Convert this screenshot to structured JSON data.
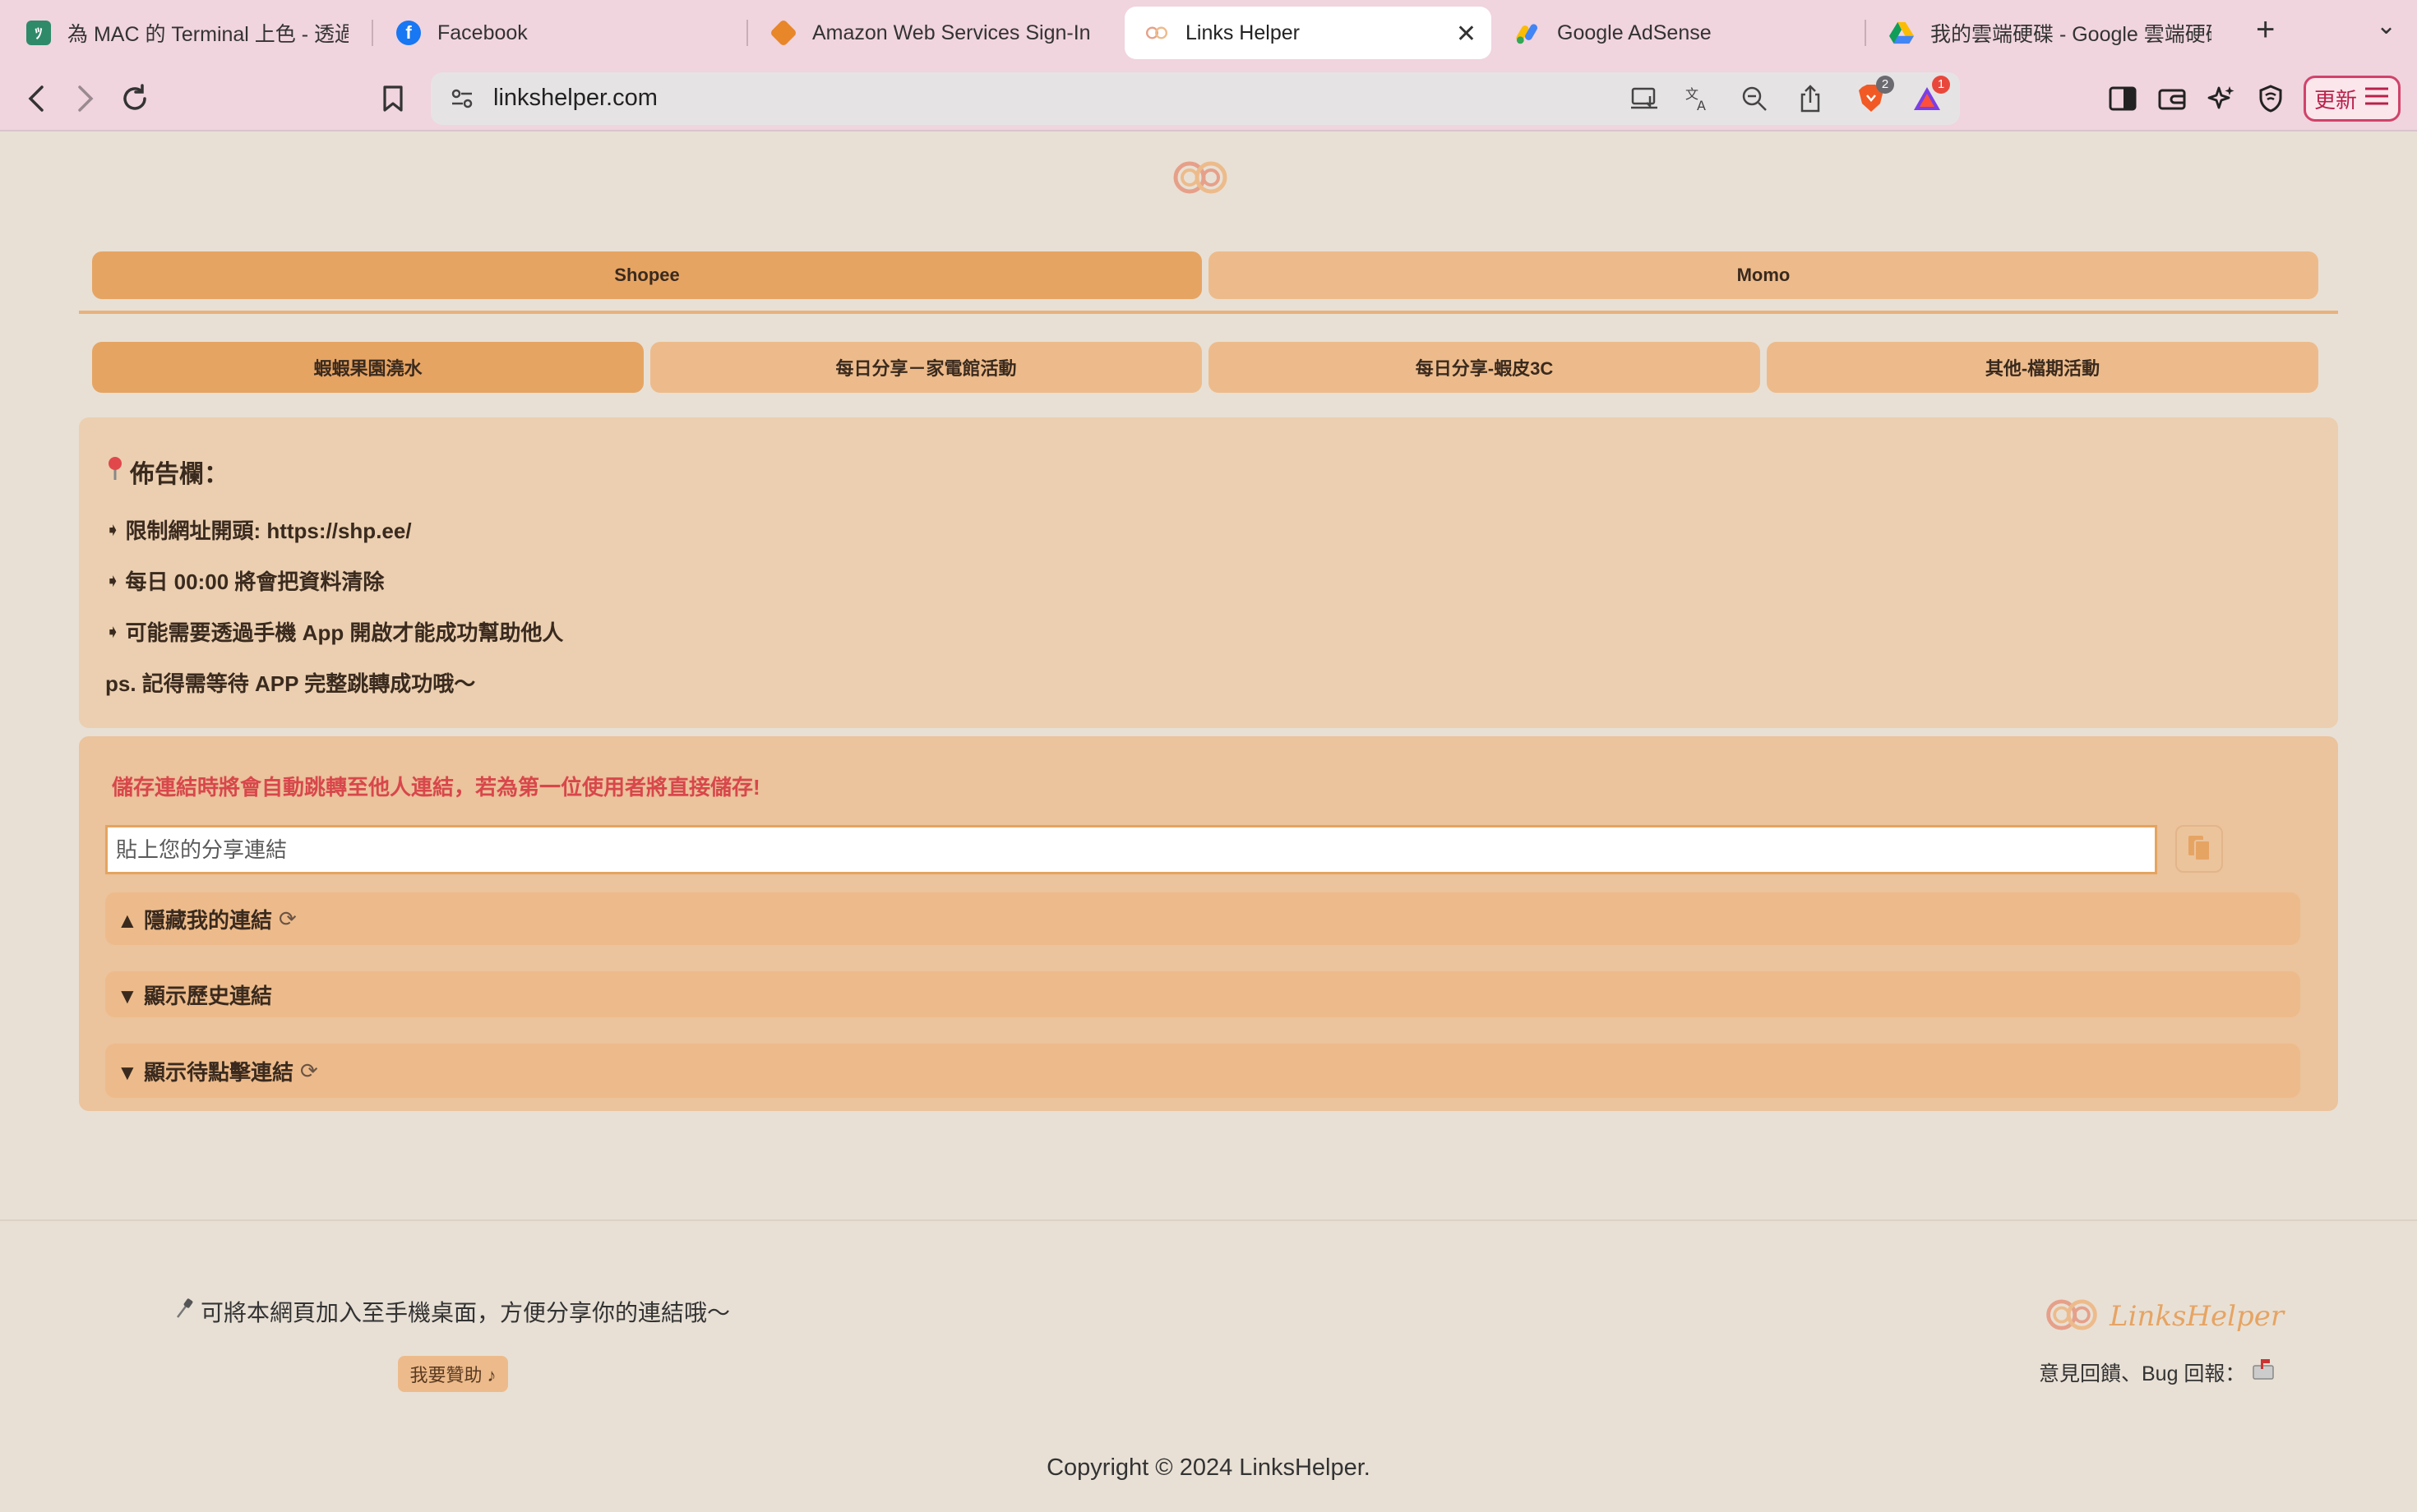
{
  "browser": {
    "tabs": [
      {
        "title": "為 MAC 的 Terminal 上色 - 透過 i",
        "active": false
      },
      {
        "title": "Facebook",
        "active": false
      },
      {
        "title": "Amazon Web Services Sign-In",
        "active": false
      },
      {
        "title": "Links Helper",
        "active": true
      },
      {
        "title": "Google AdSense",
        "active": false
      },
      {
        "title": "我的雲端硬碟 - Google 雲端硬碟",
        "active": false
      }
    ],
    "url": "linkshelper.com",
    "badges": {
      "brave_shields": "2",
      "rewards": "1"
    },
    "update_label": "更新"
  },
  "page": {
    "platform_tabs": [
      {
        "label": "Shopee",
        "selected": true
      },
      {
        "label": "Momo",
        "selected": false
      }
    ],
    "category_tabs": [
      {
        "label": "蝦蝦果園澆水",
        "selected": true
      },
      {
        "label": "每日分享－家電館活動",
        "selected": false
      },
      {
        "label": "每日分享-蝦皮3C",
        "selected": false
      },
      {
        "label": "其他-檔期活動",
        "selected": false
      }
    ],
    "notice": {
      "title": "佈告欄：",
      "lines": [
        "限制網址開頭: https://shp.ee/",
        "每日 00:00 將會把資料清除",
        "可能需要透過手機 App 開啟才能成功幫助他人"
      ],
      "ps": "ps. 記得需等待 APP 完整跳轉成功哦～"
    },
    "share": {
      "warning": "儲存連結時將會自動跳轉至他人連結，若為第一位使用者將直接儲存!",
      "input_placeholder": "貼上您的分享連結",
      "sections": {
        "my_links": "▲ 隱藏我的連結",
        "history": "▼ 顯示歷史連結",
        "pending": "▼ 顯示待點擊連結"
      }
    },
    "footer": {
      "tip": "可將本網頁加入至手機桌面，方便分享你的連結哦～",
      "donate": "我要贊助 ♪",
      "brand": "LinksHelper",
      "feedback": "意見回饋、Bug 回報：",
      "copyright": "Copyright © 2024 LinksHelper."
    }
  },
  "colors": {
    "tabbar": "#f0d4de",
    "page_bg": "#e8e0d5",
    "pill": "#edbb8b",
    "pill_selected": "#e6a463",
    "notice_bg": "#ebcfb0",
    "panel_bg": "#ebc39c",
    "warning": "#d8474b",
    "brand": "#e6a463"
  }
}
